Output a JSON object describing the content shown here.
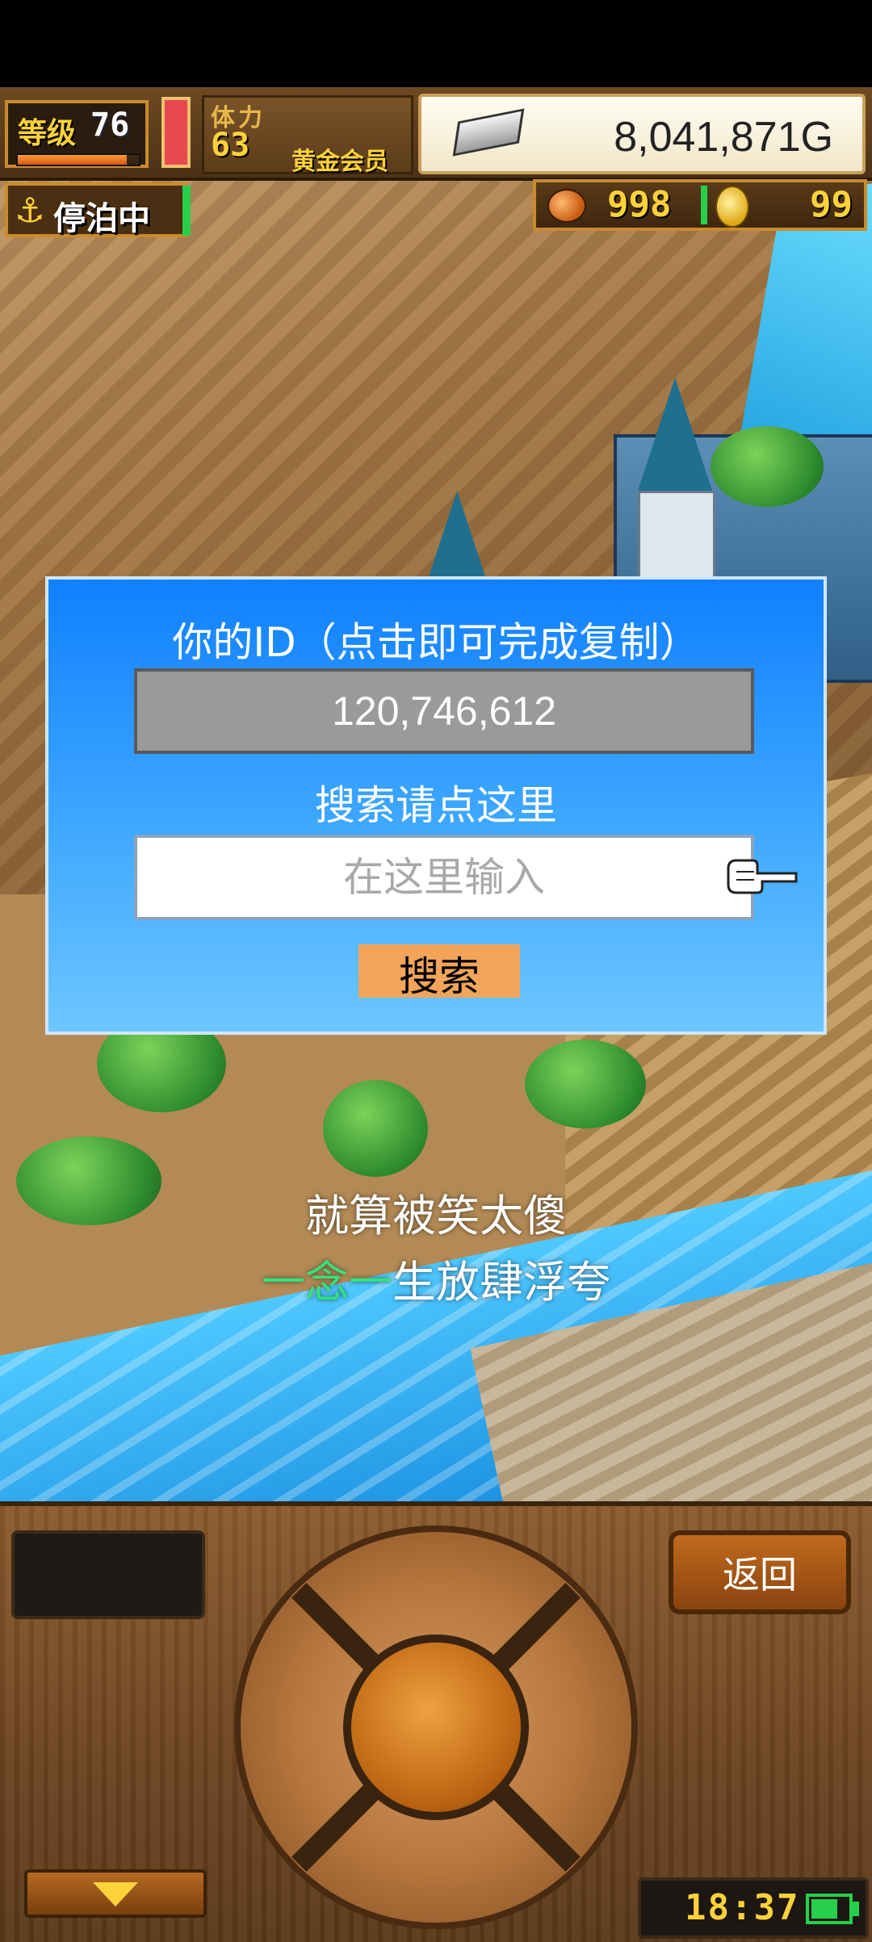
{
  "hud": {
    "level_label": "等级",
    "level_value": "76",
    "xp_progress": 0.9,
    "stamina_label": "体力",
    "stamina_value": "63",
    "member_label": "黄金会员",
    "gold_value": "8,041,871G",
    "dock_status": "停泊中",
    "food_value": "998",
    "coin_value": "99"
  },
  "dialog": {
    "title": "你的ID（点击即可完成复制）",
    "id_value": "120,746,612",
    "search_hint": "搜索请点这里",
    "search_placeholder": "在这里输入",
    "search_button": "搜索"
  },
  "lyrics": {
    "line1": "就算被笑太傻",
    "line2_highlight": "一念一",
    "line2_rest": "生放肆浮夸"
  },
  "controls": {
    "back_button": "返回",
    "clock": "18:37",
    "battery_level": 0.75
  },
  "colors": {
    "dialog_top": "#1080ff",
    "dialog_bottom": "#6dc6ff",
    "search_button": "#f2a55a",
    "accent_yellow": "#ffd23a",
    "status_green": "#27d04b"
  }
}
